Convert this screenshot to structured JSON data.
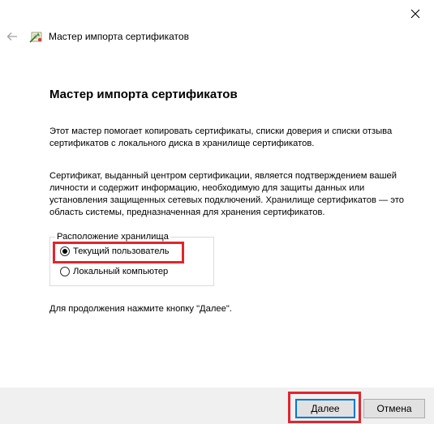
{
  "window": {
    "close_icon": "close-icon"
  },
  "header": {
    "back_icon": "back-arrow-icon",
    "wizard_icon": "certificate-wizard-icon",
    "title": "Мастер импорта сертификатов"
  },
  "main": {
    "page_title": "Мастер импорта сертификатов",
    "paragraph1": "Этот мастер помогает копировать сертификаты, списки доверия и списки отзыва сертификатов с локального диска в хранилище сертификатов.",
    "paragraph2": "Сертификат, выданный центром сертификации, является подтверждением вашей личности и содержит информацию, необходимую для защиты данных или установления защищенных сетевых подключений. Хранилище сертификатов — это область системы, предназначенная для хранения сертификатов.",
    "store_location": {
      "legend": "Расположение хранилища",
      "options": [
        {
          "label": "Текущий пользователь",
          "selected": true
        },
        {
          "label": "Локальный компьютер",
          "selected": false
        }
      ]
    },
    "continue_note": "Для продолжения нажмите кнопку \"Далее\"."
  },
  "footer": {
    "next_label": "Далее",
    "cancel_label": "Отмена"
  },
  "colors": {
    "highlight": "#e0252f",
    "focus_border": "#0078d7",
    "footer_bg": "#f0f0f0"
  }
}
